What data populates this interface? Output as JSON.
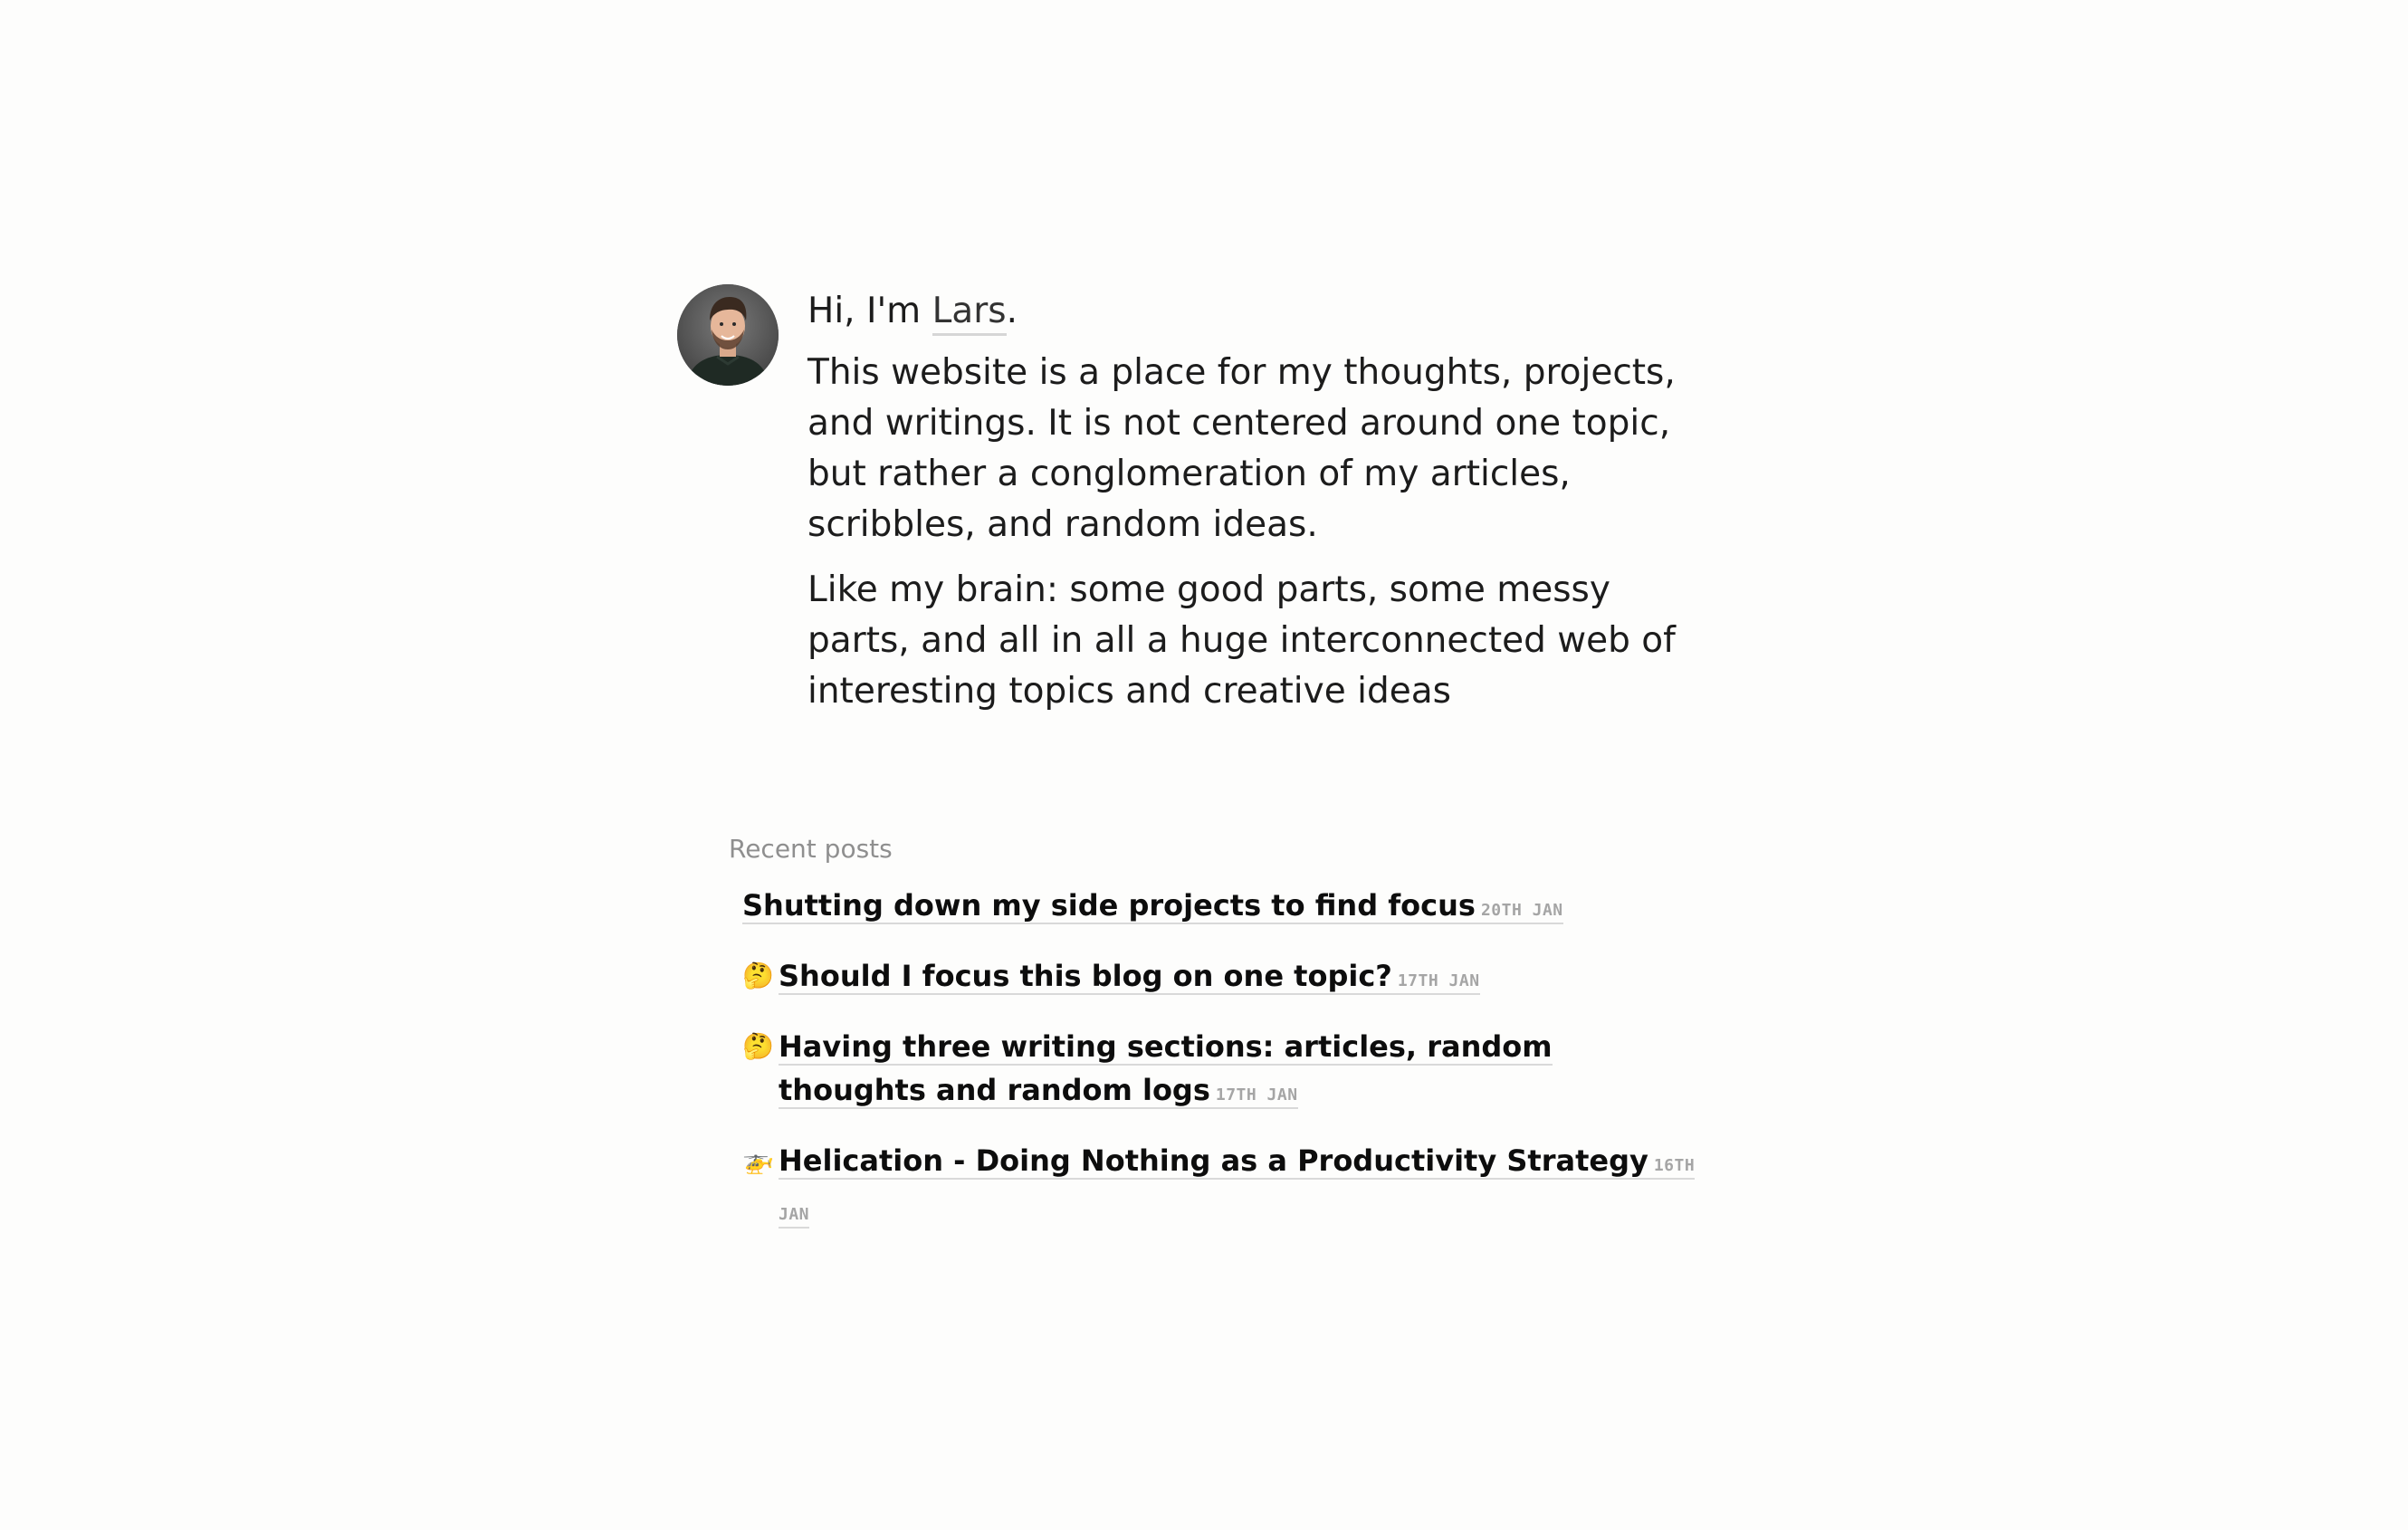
{
  "intro": {
    "greeting_prefix": "Hi, I'm ",
    "name": "Lars",
    "greeting_suffix": ".",
    "paragraph_1": "This website is a place for my thoughts, projects, and writings. It is not centered around one topic, but rather a conglomeration of my articles, scribbles, and random ideas.",
    "paragraph_2": "Like my brain: some good parts, some messy parts, and all in all a huge interconnected web of interesting topics and creative ideas"
  },
  "recent_posts": {
    "title": "Recent posts",
    "items": [
      {
        "emoji": "",
        "title": "Shutting down my side projects to find focus",
        "date": "20TH JAN"
      },
      {
        "emoji": "🤔",
        "title": "Should I focus this blog on one topic?",
        "date": "17TH JAN"
      },
      {
        "emoji": "🤔",
        "title": "Having three writing sections: articles, random thoughts and random logs",
        "date": "17TH JAN"
      },
      {
        "emoji": "🚁",
        "title": "Helication - Doing Nothing as a Productivity Strategy",
        "date": "16TH JAN"
      }
    ]
  },
  "colors": {
    "background": "#fdfdfc",
    "text": "#1c1c1c",
    "muted": "#8f8f8f",
    "date": "#a5a5a5",
    "underline": "#d9d9d9"
  }
}
